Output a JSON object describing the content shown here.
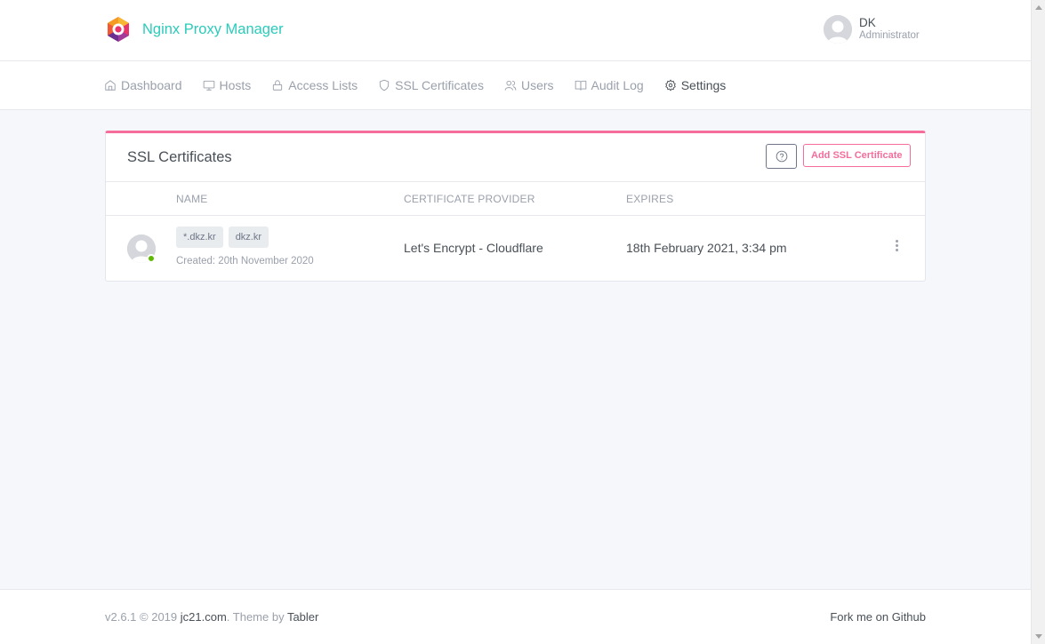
{
  "header": {
    "brand": "Nginx Proxy Manager",
    "user": {
      "name": "DK",
      "role": "Administrator"
    }
  },
  "nav": [
    {
      "label": "Dashboard",
      "icon": "home-icon"
    },
    {
      "label": "Hosts",
      "icon": "monitor-icon"
    },
    {
      "label": "Access Lists",
      "icon": "lock-icon"
    },
    {
      "label": "SSL Certificates",
      "icon": "shield-icon"
    },
    {
      "label": "Users",
      "icon": "users-icon"
    },
    {
      "label": "Audit Log",
      "icon": "book-icon"
    },
    {
      "label": "Settings",
      "icon": "gear-icon"
    }
  ],
  "card": {
    "title": "SSL Certificates",
    "add_button": "Add SSL Certificate",
    "columns": {
      "name": "NAME",
      "provider": "CERTIFICATE PROVIDER",
      "expires": "EXPIRES"
    },
    "rows": [
      {
        "domains": [
          "*.dkz.kr",
          "dkz.kr"
        ],
        "created": "Created: 20th November 2020",
        "provider": "Let's Encrypt - Cloudflare",
        "expires": "18th February 2021, 3:34 pm"
      }
    ]
  },
  "footer": {
    "version": "v2.6.1 © 2019 ",
    "company": "jc21.com",
    "theme_prefix": ". Theme by ",
    "theme": "Tabler",
    "github": "Fork me on Github"
  },
  "colors": {
    "brand": "#2bcbba",
    "accent": "#f66d9b",
    "status_online": "#5eba00"
  }
}
